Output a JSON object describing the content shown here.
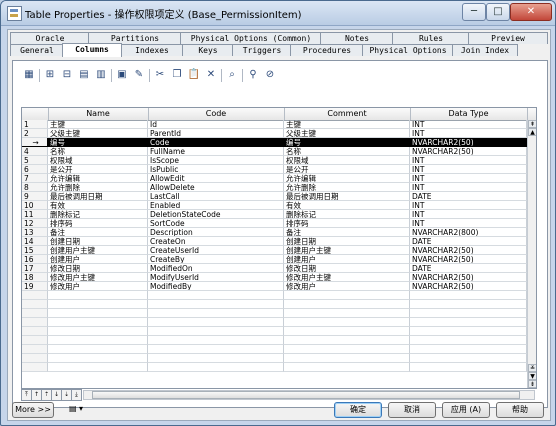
{
  "window": {
    "title": "Table Properties - 操作权限项定义 (Base_PermissionItem)",
    "minimize_label": "─",
    "maximize_label": "□",
    "close_label": "✕"
  },
  "tabs_row1": [
    {
      "label": "Oracle"
    },
    {
      "label": "Partitions"
    },
    {
      "label": "Physical Options (Common)"
    },
    {
      "label": "Notes"
    },
    {
      "label": "Rules"
    },
    {
      "label": "Preview"
    }
  ],
  "tabs_row2": [
    {
      "label": "General"
    },
    {
      "label": "Columns"
    },
    {
      "label": "Indexes"
    },
    {
      "label": "Keys"
    },
    {
      "label": "Triggers"
    },
    {
      "label": "Procedures"
    },
    {
      "label": "Physical Options"
    },
    {
      "label": "Join Index"
    }
  ],
  "active_tab": "Columns",
  "toolbar": {
    "icons": [
      "properties-icon",
      "add-row-icon",
      "insert-row-icon",
      "add-columns-icon",
      "reuse-columns-icon",
      "new-domain-icon",
      "find-icon",
      "cut-icon",
      "copy-icon",
      "paste-icon",
      "delete-icon",
      "search-icon",
      "filter-icon",
      "clear-filter-icon"
    ]
  },
  "grid": {
    "headers": [
      "",
      "Name",
      "Code",
      "Comment",
      "Data Type"
    ],
    "current_row_marker": "→",
    "rows": [
      {
        "n": "1",
        "name": "主键",
        "code": "Id",
        "comment": "主键",
        "type": "INT"
      },
      {
        "n": "2",
        "name": "父级主键",
        "code": "ParentId",
        "comment": "父级主键",
        "type": "INT"
      },
      {
        "n": "→",
        "name": "编号",
        "code": "Code",
        "comment": "编号",
        "type": "NVARCHAR2(50)"
      },
      {
        "n": "4",
        "name": "名称",
        "code": "FullName",
        "comment": "名称",
        "type": "NVARCHAR2(50)"
      },
      {
        "n": "5",
        "name": "权限域",
        "code": "IsScope",
        "comment": "权限域",
        "type": "INT"
      },
      {
        "n": "6",
        "name": "是公开",
        "code": "IsPublic",
        "comment": "是公开",
        "type": "INT"
      },
      {
        "n": "7",
        "name": "允许编辑",
        "code": "AllowEdit",
        "comment": "允许编辑",
        "type": "INT"
      },
      {
        "n": "8",
        "name": "允许删除",
        "code": "AllowDelete",
        "comment": "允许删除",
        "type": "INT"
      },
      {
        "n": "9",
        "name": "最后被调用日期",
        "code": "LastCall",
        "comment": "最后被调用日期",
        "type": "DATE"
      },
      {
        "n": "10",
        "name": "有效",
        "code": "Enabled",
        "comment": "有效",
        "type": "INT"
      },
      {
        "n": "11",
        "name": "删除标记",
        "code": "DeletionStateCode",
        "comment": "删除标记",
        "type": "INT"
      },
      {
        "n": "12",
        "name": "排序码",
        "code": "SortCode",
        "comment": "排序码",
        "type": "INT"
      },
      {
        "n": "13",
        "name": "备注",
        "code": "Description",
        "comment": "备注",
        "type": "NVARCHAR2(800)"
      },
      {
        "n": "14",
        "name": "创建日期",
        "code": "CreateOn",
        "comment": "创建日期",
        "type": "DATE"
      },
      {
        "n": "15",
        "name": "创建用户主键",
        "code": "CreateUserId",
        "comment": "创建用户主键",
        "type": "NVARCHAR2(50)"
      },
      {
        "n": "16",
        "name": "创建用户",
        "code": "CreateBy",
        "comment": "创建用户",
        "type": "NVARCHAR2(50)"
      },
      {
        "n": "17",
        "name": "修改日期",
        "code": "ModifiedOn",
        "comment": "修改日期",
        "type": "DATE"
      },
      {
        "n": "18",
        "name": "修改用户主键",
        "code": "ModifyUserId",
        "comment": "修改用户主键",
        "type": "NVARCHAR2(50)"
      },
      {
        "n": "19",
        "name": "修改用户",
        "code": "ModifiedBy",
        "comment": "修改用户",
        "type": "NVARCHAR2(50)"
      }
    ],
    "selected_row": 2
  },
  "footer": {
    "more_label": "More >>",
    "ok_label": "确定",
    "cancel_label": "取消",
    "apply_label": "应用 (A)",
    "help_label": "帮助"
  }
}
